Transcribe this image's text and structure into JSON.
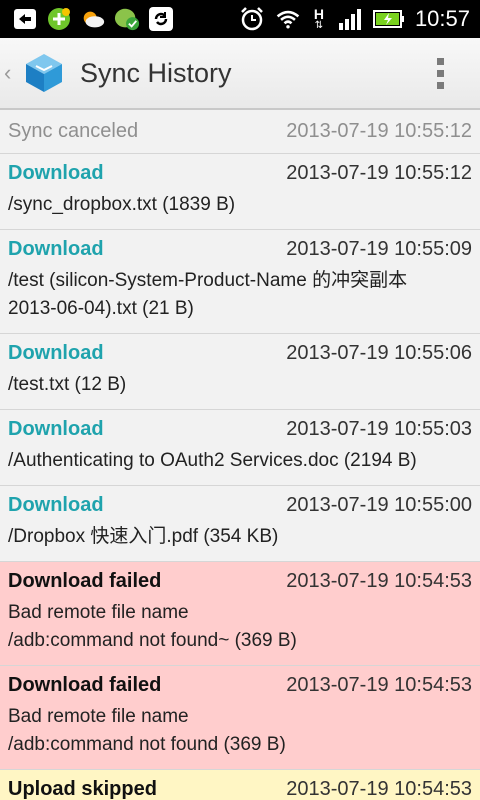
{
  "statusbar": {
    "time": "10:57",
    "network_h": "H"
  },
  "actionbar": {
    "title": "Sync History"
  },
  "entries": [
    {
      "status": "Sync canceled",
      "time": "2013-07-19 10:55:12",
      "lines": [],
      "kind": "canceled"
    },
    {
      "status": "Download",
      "time": "2013-07-19 10:55:12",
      "lines": [
        "/sync_dropbox.txt (1839 B)"
      ],
      "kind": "download"
    },
    {
      "status": "Download",
      "time": "2013-07-19 10:55:09",
      "lines": [
        "/test (silicon-System-Product-Name 的冲突副本",
        "2013-06-04).txt (21 B)"
      ],
      "kind": "download"
    },
    {
      "status": "Download",
      "time": "2013-07-19 10:55:06",
      "lines": [
        "/test.txt (12 B)"
      ],
      "kind": "download"
    },
    {
      "status": "Download",
      "time": "2013-07-19 10:55:03",
      "lines": [
        "/Authenticating to OAuth2 Services.doc (2194 B)"
      ],
      "kind": "download"
    },
    {
      "status": "Download",
      "time": "2013-07-19 10:55:00",
      "lines": [
        "/Dropbox 快速入门.pdf (354 KB)"
      ],
      "kind": "download"
    },
    {
      "status": "Download failed",
      "time": "2013-07-19 10:54:53",
      "lines": [
        "Bad remote file name",
        "/adb:command not found~ (369 B)"
      ],
      "kind": "failed"
    },
    {
      "status": "Download failed",
      "time": "2013-07-19 10:54:53",
      "lines": [
        "Bad remote file name",
        "/adb:command not found (369 B)"
      ],
      "kind": "failed"
    },
    {
      "status": "Upload skipped",
      "time": "2013-07-19 10:54:53",
      "lines": [],
      "kind": "skipped"
    }
  ],
  "colors": {
    "download": "#1fa3ad",
    "failed_bg": "#ffcdcd",
    "skipped_bg": "#fff6c4"
  },
  "icons": [
    "back-icon",
    "add-app-icon",
    "weather-icon",
    "sync-status-icon",
    "refresh-icon",
    "alarm-icon",
    "wifi-icon",
    "signal-icon",
    "battery-icon",
    "app-logo-icon",
    "overflow-menu-icon"
  ]
}
